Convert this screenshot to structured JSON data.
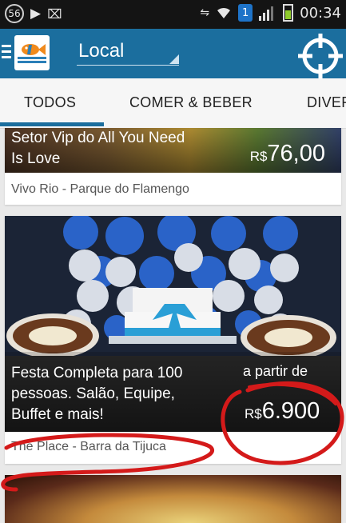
{
  "status_bar": {
    "notification_count": "56",
    "sim_badge": "1",
    "time": "00:34"
  },
  "app_bar": {
    "title": "Local",
    "brand_color": "#1b6e9e"
  },
  "tabs": [
    {
      "label": "TODOS",
      "selected": true
    },
    {
      "label": "COMER & BEBER",
      "selected": false
    },
    {
      "label": "DIVER",
      "selected": false
    }
  ],
  "cards": [
    {
      "title_line1": "Setor Vip do All You Need",
      "title_line2": "Is Love",
      "price_currency": "R$",
      "price_value": "76,00",
      "venue": "Vivo Rio - Parque do Flamengo"
    },
    {
      "title_line1": "Festa Completa para 100",
      "title_line2": "pessoas. Salão, Equipe,",
      "title_line3": "Buffet e mais!",
      "price_prefix": "a partir de",
      "price_currency": "R$",
      "price_value": "6.900",
      "venue": "The Place - Barra da Tijuca"
    }
  ],
  "annotation_color": "#d41a1a"
}
